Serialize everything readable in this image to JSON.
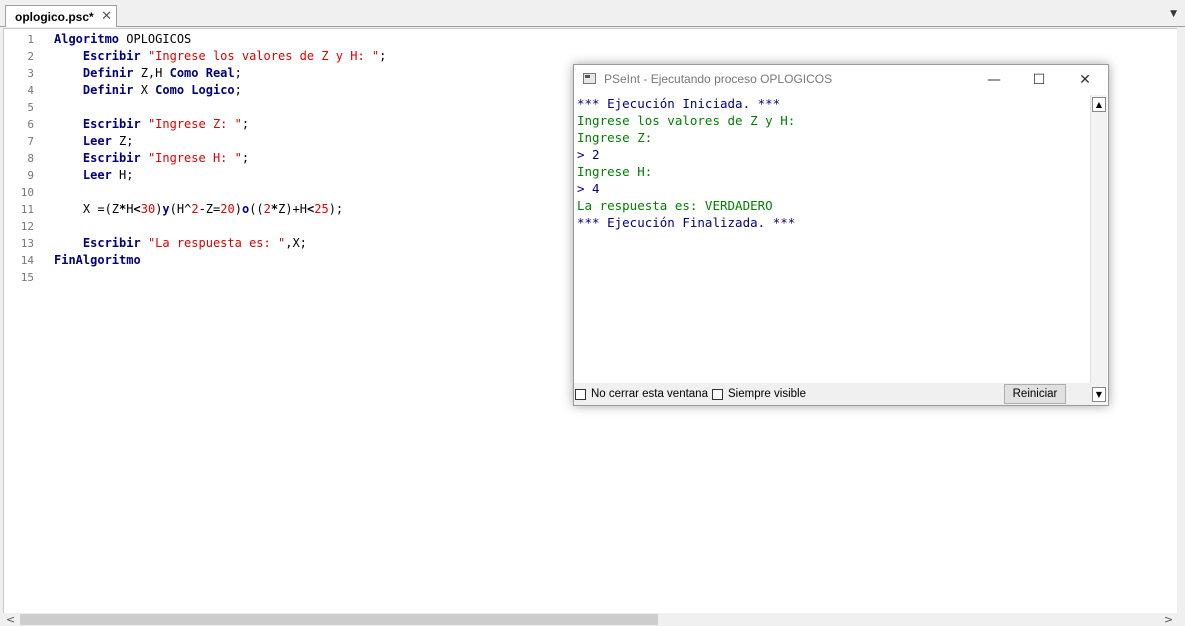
{
  "tab": {
    "label": "oplogico.psc*",
    "close": "✕",
    "menu": "▼"
  },
  "editor": {
    "line_numbers": [
      "1",
      "2",
      "3",
      "4",
      "5",
      "6",
      "7",
      "8",
      "9",
      "10",
      "11",
      "12",
      "13",
      "14",
      "15"
    ],
    "lines": [
      [
        {
          "t": "Algoritmo",
          "c": "kw"
        },
        {
          "t": " OPLOGICOS",
          "c": ""
        }
      ],
      [
        {
          "t": "    ",
          "c": ""
        },
        {
          "t": "Escribir",
          "c": "kw"
        },
        {
          "t": " ",
          "c": ""
        },
        {
          "t": "\"Ingrese los valores de Z y H: \"",
          "c": "str"
        },
        {
          "t": ";",
          "c": ""
        }
      ],
      [
        {
          "t": "    ",
          "c": ""
        },
        {
          "t": "Definir",
          "c": "kw"
        },
        {
          "t": " Z,H ",
          "c": ""
        },
        {
          "t": "Como Real",
          "c": "kw"
        },
        {
          "t": ";",
          "c": ""
        }
      ],
      [
        {
          "t": "    ",
          "c": ""
        },
        {
          "t": "Definir",
          "c": "kw"
        },
        {
          "t": " X ",
          "c": ""
        },
        {
          "t": "Como Logico",
          "c": "kw"
        },
        {
          "t": ";",
          "c": ""
        }
      ],
      [],
      [
        {
          "t": "    ",
          "c": ""
        },
        {
          "t": "Escribir",
          "c": "kw"
        },
        {
          "t": " ",
          "c": ""
        },
        {
          "t": "\"Ingrese Z: \"",
          "c": "str"
        },
        {
          "t": ";",
          "c": ""
        }
      ],
      [
        {
          "t": "    ",
          "c": ""
        },
        {
          "t": "Leer",
          "c": "kw"
        },
        {
          "t": " Z;",
          "c": ""
        }
      ],
      [
        {
          "t": "    ",
          "c": ""
        },
        {
          "t": "Escribir",
          "c": "kw"
        },
        {
          "t": " ",
          "c": ""
        },
        {
          "t": "\"Ingrese H: \"",
          "c": "str"
        },
        {
          "t": ";",
          "c": ""
        }
      ],
      [
        {
          "t": "    ",
          "c": ""
        },
        {
          "t": "Leer",
          "c": "kw"
        },
        {
          "t": " H;",
          "c": ""
        }
      ],
      [],
      [
        {
          "t": "    X =(Z",
          "c": ""
        },
        {
          "t": "*",
          "c": "op"
        },
        {
          "t": "H",
          "c": ""
        },
        {
          "t": "<",
          "c": "op"
        },
        {
          "t": "30",
          "c": "num"
        },
        {
          "t": ")",
          "c": ""
        },
        {
          "t": "y",
          "c": "kw"
        },
        {
          "t": "(H^",
          "c": ""
        },
        {
          "t": "2",
          "c": "num"
        },
        {
          "t": "-Z=",
          "c": ""
        },
        {
          "t": "20",
          "c": "num"
        },
        {
          "t": ")",
          "c": ""
        },
        {
          "t": "o",
          "c": "kw"
        },
        {
          "t": "((",
          "c": ""
        },
        {
          "t": "2",
          "c": "num"
        },
        {
          "t": "*",
          "c": "op"
        },
        {
          "t": "Z)+H",
          "c": ""
        },
        {
          "t": "<",
          "c": "op"
        },
        {
          "t": "25",
          "c": "num"
        },
        {
          "t": ");",
          "c": ""
        }
      ],
      [],
      [
        {
          "t": "    ",
          "c": ""
        },
        {
          "t": "Escribir",
          "c": "kw"
        },
        {
          "t": " ",
          "c": ""
        },
        {
          "t": "\"La respuesta es: \"",
          "c": "str"
        },
        {
          "t": ",X;",
          "c": ""
        }
      ],
      [
        {
          "t": "FinAlgoritmo",
          "c": "kw"
        }
      ],
      []
    ]
  },
  "run_window": {
    "title": "PSeInt - Ejecutando proceso OPLOGICOS",
    "minimize": "—",
    "maximize": "☐",
    "close": "✕",
    "console": [
      {
        "text": "*** Ejecución Iniciada. ***",
        "color": "blue"
      },
      {
        "text": "Ingrese los valores de Z y H:",
        "color": "green"
      },
      {
        "text": "Ingrese Z:",
        "color": "green"
      },
      {
        "text": "> 2",
        "color": "blue"
      },
      {
        "text": "Ingrese H:",
        "color": "green"
      },
      {
        "text": "> 4",
        "color": "blue"
      },
      {
        "text": "La respuesta es: VERDADERO",
        "color": "green"
      },
      {
        "text": "*** Ejecución Finalizada. ***",
        "color": "blue"
      }
    ],
    "checkbox_keep_open": "No cerrar esta ventana",
    "checkbox_always_visible": "Siempre visible",
    "restart_button": "Reiniciar"
  },
  "colors": {
    "keyword": "#000080",
    "string": "#e00000",
    "console_green": "#008000",
    "console_blue": "#000080"
  }
}
